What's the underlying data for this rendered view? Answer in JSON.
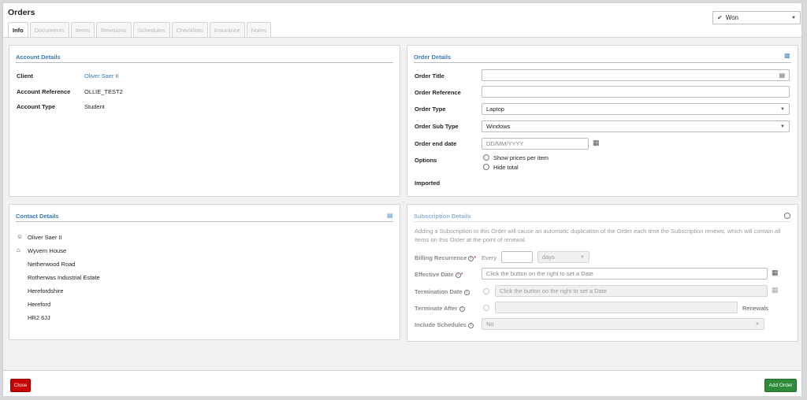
{
  "page": {
    "title": "Orders"
  },
  "tabs": [
    {
      "label": "Info",
      "active": true
    },
    {
      "label": "Documents",
      "active": false
    },
    {
      "label": "Items",
      "active": false
    },
    {
      "label": "Revisions",
      "active": false
    },
    {
      "label": "Schedules",
      "active": false
    },
    {
      "label": "Checklists",
      "active": false
    },
    {
      "label": "Insurance",
      "active": false
    },
    {
      "label": "Notes",
      "active": false
    }
  ],
  "status": {
    "value": "Won",
    "icon": "check-circle-icon"
  },
  "account": {
    "title": "Account Details",
    "client_label": "Client",
    "client_value": "Oliver Saer II",
    "reference_label": "Account Reference",
    "reference_value": "OLLIE_TEST2",
    "type_label": "Account Type",
    "type_value": "Student"
  },
  "contact": {
    "title": "Contact Details",
    "name": "Oliver Saer II",
    "house": "Wyvern House",
    "address_lines": [
      "Netherwood Road",
      "Rotherwas Industrial Estate",
      "Herefordshire",
      "Hereford",
      "HR2 6JJ"
    ]
  },
  "order": {
    "title": "Order Details",
    "title_label": "Order Title",
    "title_value": "",
    "reference_label": "Order Reference",
    "reference_value": "",
    "type_label": "Order Type",
    "type_value": "Laptop",
    "subtype_label": "Order Sub Type",
    "subtype_value": "Windows",
    "enddate_label": "Order end date",
    "enddate_placeholder": "DD/MM/YYYY",
    "options_label": "Options",
    "option_1": "Show prices per item",
    "option_2": "Hide total",
    "imported_label": "Imported"
  },
  "subscription": {
    "title": "Subscription Details",
    "note": "Adding a Subscription to this Order will cause an automatic duplication of the Order each time the Subscription renews, which will contain all Items on this Order at the point of renewal.",
    "billing_label": "Billing Recurrence",
    "billing_every": "Every",
    "billing_unit": "days",
    "effective_label": "Effective Date",
    "effective_placeholder": "Click the button on the right to set a Date",
    "termination_label": "Termination Date",
    "termination_placeholder": "Click the button on the right to set a Date",
    "terminate_after_label": "Terminate After",
    "renewals_label": "Renewals",
    "schedules_label": "Include Schedules",
    "schedules_value": "No"
  },
  "footer": {
    "close_label": "Close",
    "add_label": "Add Order"
  },
  "colors": {
    "accent": "#3a7ab8",
    "close": "#c90000",
    "add": "#2f8a3a"
  }
}
